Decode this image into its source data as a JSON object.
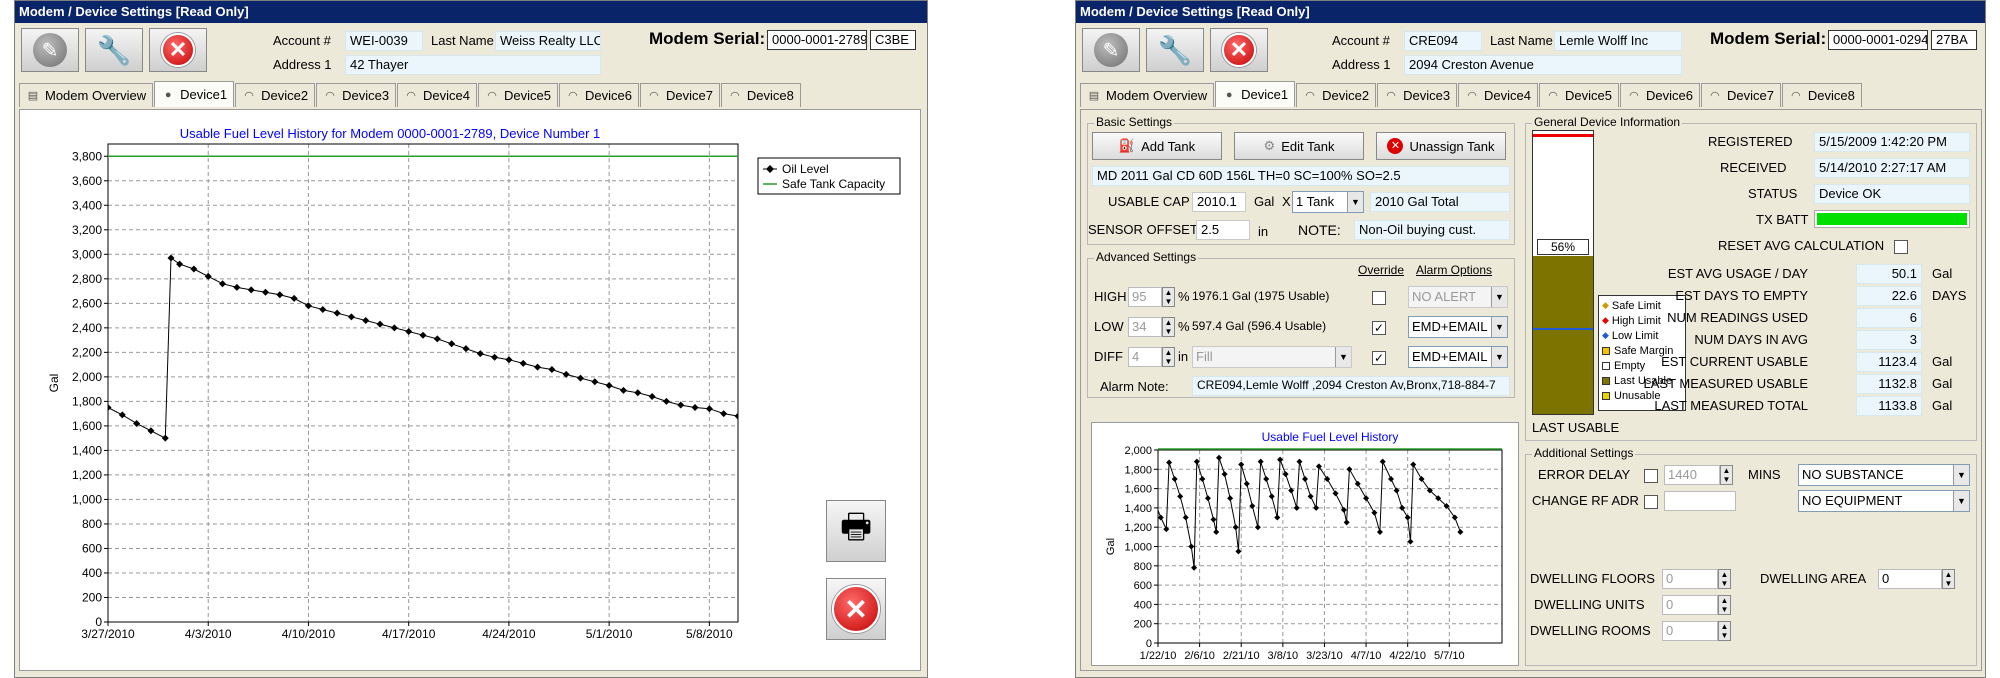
{
  "left": {
    "title": "Modem / Device Settings [Read Only]",
    "account_label": "Account #",
    "account": "WEI-0039",
    "lastname_label": "Last Name",
    "lastname": "Weiss Realty LLC",
    "address_label": "Address 1",
    "address": "42 Thayer",
    "serial_label": "Modem Serial:",
    "serial": "0000-0001-2789",
    "serial_suffix": "C3BE",
    "tabs": [
      "Modem Overview",
      "Device1",
      "Device2",
      "Device3",
      "Device4",
      "Device5",
      "Device6",
      "Device7",
      "Device8"
    ],
    "chart_data": {
      "type": "line",
      "title": "Usable Fuel Level History for Modem 0000-0001-2789, Device Number 1",
      "ylabel": "Gal",
      "xlabel": "",
      "ylim": [
        0,
        3900
      ],
      "yticks": [
        0,
        200,
        400,
        600,
        800,
        1000,
        1200,
        1400,
        1600,
        1800,
        2000,
        2200,
        2400,
        2600,
        2800,
        3000,
        3200,
        3400,
        3600,
        3800
      ],
      "xlim": [
        0,
        44
      ],
      "xticks": [
        {
          "x": 0,
          "label": "3/27/2010"
        },
        {
          "x": 7,
          "label": "4/3/2010"
        },
        {
          "x": 14,
          "label": "4/10/2010"
        },
        {
          "x": 21,
          "label": "4/17/2010"
        },
        {
          "x": 28,
          "label": "4/24/2010"
        },
        {
          "x": 35,
          "label": "5/1/2010"
        },
        {
          "x": 42,
          "label": "5/8/2010"
        }
      ],
      "legend": [
        "Oil Level",
        "Safe Tank Capacity"
      ],
      "legend_position": "top-right",
      "grid": true,
      "safe_capacity": 3800,
      "series": [
        {
          "name": "Oil Level",
          "points": [
            [
              0,
              1750
            ],
            [
              1,
              1690
            ],
            [
              2,
              1620
            ],
            [
              3,
              1560
            ],
            [
              4,
              1500
            ],
            [
              4.4,
              2970
            ],
            [
              5,
              2920
            ],
            [
              6,
              2880
            ],
            [
              7,
              2820
            ],
            [
              8,
              2760
            ],
            [
              9,
              2730
            ],
            [
              10,
              2710
            ],
            [
              11,
              2690
            ],
            [
              12,
              2670
            ],
            [
              13,
              2640
            ],
            [
              14,
              2580
            ],
            [
              15,
              2550
            ],
            [
              16,
              2520
            ],
            [
              17,
              2490
            ],
            [
              18,
              2460
            ],
            [
              19,
              2430
            ],
            [
              20,
              2400
            ],
            [
              21,
              2370
            ],
            [
              22,
              2340
            ],
            [
              23,
              2310
            ],
            [
              24,
              2270
            ],
            [
              25,
              2230
            ],
            [
              26,
              2190
            ],
            [
              27,
              2160
            ],
            [
              28,
              2140
            ],
            [
              29,
              2110
            ],
            [
              30,
              2080
            ],
            [
              31,
              2060
            ],
            [
              32,
              2020
            ],
            [
              33,
              1990
            ],
            [
              34,
              1960
            ],
            [
              35,
              1930
            ],
            [
              36,
              1890
            ],
            [
              37,
              1870
            ],
            [
              38,
              1840
            ],
            [
              39,
              1800
            ],
            [
              40,
              1770
            ],
            [
              41,
              1750
            ],
            [
              42,
              1740
            ],
            [
              43,
              1700
            ],
            [
              44,
              1680
            ],
            [
              45,
              1720
            ]
          ]
        }
      ]
    }
  },
  "right": {
    "title": "Modem / Device Settings [Read Only]",
    "account_label": "Account #",
    "account": "CRE094",
    "lastname_label": "Last Name",
    "lastname": "Lemle Wolff Inc",
    "address_label": "Address 1",
    "address": "2094 Creston Avenue",
    "serial_label": "Modem Serial:",
    "serial": "0000-0001-0294",
    "serial_suffix": "27BA",
    "tabs": [
      "Modem Overview",
      "Device1",
      "Device2",
      "Device3",
      "Device4",
      "Device5",
      "Device6",
      "Device7",
      "Device8"
    ],
    "basic": {
      "title": "Basic Settings",
      "add_tank": "Add Tank",
      "edit_tank": "Edit Tank",
      "unassign_tank": "Unassign Tank",
      "description": "MD 2011 Gal CD 60D 156L TH=0 SC=100% SO=2.5",
      "usable_cap_label": "USABLE CAP",
      "usable_cap": "2010.1",
      "gal": "Gal",
      "x": "X",
      "tanks": "1 Tank",
      "total": "2010 Gal Total",
      "sensor_offset_label": "SENSOR OFFSET",
      "sensor_offset": "2.5",
      "in": "in",
      "note_label": "NOTE:",
      "note": "Non-Oil buying cust."
    },
    "advanced": {
      "title": "Advanced Settings",
      "override_label": "Override",
      "alarm_options_label": "Alarm Options",
      "high_label": "HIGH",
      "high_val": "95",
      "high_unit": "%",
      "high_desc": "1976.1 Gal  (1975 Usable)",
      "high_alarm": "NO ALERT",
      "low_label": "LOW",
      "low_val": "34",
      "low_unit": "%",
      "low_desc": "597.4 Gal  (596.4 Usable)",
      "low_alarm": "EMD+EMAIL",
      "diff_label": "DIFF",
      "diff_val": "4",
      "diff_unit": "in",
      "diff_sel": "Fill",
      "diff_alarm": "EMD+EMAIL",
      "alarm_note_label": "Alarm Note:",
      "alarm_note": "CRE094,Lemle Wolff ,2094 Creston Av,Bronx,718-884-7"
    },
    "small_chart": {
      "chart_data": {
        "type": "line",
        "title": "Usable Fuel Level History",
        "ylabel": "Gal",
        "ylim": [
          0,
          2000
        ],
        "yticks": [
          0,
          200,
          400,
          600,
          800,
          1000,
          1200,
          1400,
          1600,
          1800,
          2000
        ],
        "xlim": [
          0,
          124
        ],
        "xticks": [
          {
            "x": 0,
            "label": "1/22/10"
          },
          {
            "x": 15,
            "label": "2/6/10"
          },
          {
            "x": 30,
            "label": "2/21/10"
          },
          {
            "x": 45,
            "label": "3/8/10"
          },
          {
            "x": 60,
            "label": "3/23/10"
          },
          {
            "x": 75,
            "label": "4/7/10"
          },
          {
            "x": 90,
            "label": "4/22/10"
          },
          {
            "x": 105,
            "label": "5/7/10"
          }
        ],
        "grid": true,
        "safe_capacity": 2010,
        "series": [
          {
            "name": "",
            "points": [
              [
                -3,
                1580
              ],
              [
                -1,
                1450
              ],
              [
                1,
                1300
              ],
              [
                3,
                1180
              ],
              [
                4,
                1870
              ],
              [
                6,
                1700
              ],
              [
                8,
                1520
              ],
              [
                10,
                1300
              ],
              [
                12,
                1000
              ],
              [
                13,
                780
              ],
              [
                14,
                1880
              ],
              [
                16,
                1700
              ],
              [
                18,
                1500
              ],
              [
                20,
                1280
              ],
              [
                21,
                1150
              ],
              [
                22,
                1920
              ],
              [
                24,
                1750
              ],
              [
                26,
                1500
              ],
              [
                28,
                1200
              ],
              [
                29,
                950
              ],
              [
                30,
                1850
              ],
              [
                32,
                1650
              ],
              [
                34,
                1420
              ],
              [
                36,
                1200
              ],
              [
                37,
                1880
              ],
              [
                39,
                1700
              ],
              [
                41,
                1520
              ],
              [
                43,
                1300
              ],
              [
                44,
                1900
              ],
              [
                46,
                1750
              ],
              [
                48,
                1580
              ],
              [
                50,
                1400
              ],
              [
                51,
                1880
              ],
              [
                53,
                1700
              ],
              [
                55,
                1520
              ],
              [
                57,
                1400
              ],
              [
                58,
                1830
              ],
              [
                61,
                1700
              ],
              [
                64,
                1550
              ],
              [
                67,
                1380
              ],
              [
                68,
                1250
              ],
              [
                69,
                1800
              ],
              [
                72,
                1650
              ],
              [
                75,
                1500
              ],
              [
                78,
                1350
              ],
              [
                80,
                1150
              ],
              [
                81,
                1880
              ],
              [
                84,
                1700
              ],
              [
                86,
                1580
              ],
              [
                88,
                1400
              ],
              [
                90,
                1300
              ],
              [
                91,
                1050
              ],
              [
                92,
                1850
              ],
              [
                95,
                1700
              ],
              [
                98,
                1580
              ],
              [
                101,
                1500
              ],
              [
                104,
                1420
              ],
              [
                107,
                1300
              ],
              [
                109,
                1150
              ]
            ]
          }
        ]
      }
    },
    "general": {
      "title": "General Device Information",
      "tank_pct": "56%",
      "tank_fill": 0.56,
      "legend": [
        "Safe Limit",
        "High Limit",
        "Low Limit",
        "Safe Margin",
        "Empty",
        "Last Usable",
        "Unusable"
      ],
      "last_usable_label": "LAST USABLE",
      "registered_label": "REGISTERED",
      "registered": "5/15/2009 1:42:20 PM",
      "received_label": "RECEIVED",
      "received": "5/14/2010 2:27:17 AM",
      "status_label": "STATUS",
      "status": "Device OK",
      "tx_batt_label": "TX BATT",
      "tx_batt_level": 1.0,
      "reset_label": "RESET AVG CALCULATION",
      "rows": [
        {
          "label": "EST AVG USAGE / DAY",
          "value": "50.1",
          "unit": "Gal"
        },
        {
          "label": "EST DAYS TO EMPTY",
          "value": "22.6",
          "unit": "DAYS"
        },
        {
          "label": "NUM READINGS USED",
          "value": "6",
          "unit": ""
        },
        {
          "label": "NUM DAYS IN AVG",
          "value": "3",
          "unit": ""
        },
        {
          "label": "EST CURRENT USABLE",
          "value": "1123.4",
          "unit": "Gal"
        },
        {
          "label": "LAST MEASURED USABLE",
          "value": "1132.8",
          "unit": "Gal"
        },
        {
          "label": "LAST MEASURED TOTAL",
          "value": "1133.8",
          "unit": "Gal"
        }
      ]
    },
    "additional": {
      "title": "Additional Settings",
      "error_delay_label": "ERROR DELAY",
      "error_delay": "1440",
      "mins": "MINS",
      "change_rf_label": "CHANGE RF ADR",
      "substance": "NO SUBSTANCE",
      "equipment": "NO EQUIPMENT",
      "dwelling_floors_label": "DWELLING FLOORS",
      "dwelling_floors": "0",
      "dwelling_area_label": "DWELLING AREA",
      "dwelling_area": "0",
      "dwelling_units_label": "DWELLING UNITS",
      "dwelling_units": "0",
      "dwelling_rooms_label": "DWELLING ROOMS",
      "dwelling_rooms": "0"
    }
  }
}
